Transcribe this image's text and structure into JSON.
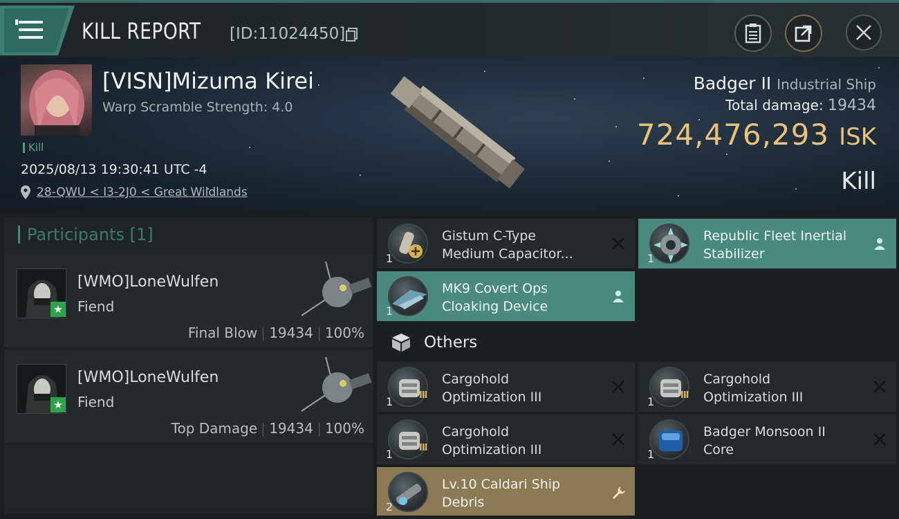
{
  "header": {
    "title": "KILL REPORT",
    "report_id": "[ID:11024450]",
    "icons": [
      "menu-icon",
      "copy-icon",
      "clipboard-icon",
      "share-icon",
      "close-icon"
    ]
  },
  "victim": {
    "name": "[VISN]Mizuma Kirei",
    "warp_scramble": "Warp Scramble Strength: 4.0",
    "result_tag": "Kill",
    "timestamp": "2025/08/13 19:30:41 UTC -4",
    "location": "28-QWU < I3-2J0 < Great Wildlands",
    "ship_name": "Badger II",
    "ship_class": "Industrial Ship",
    "total_damage_label": "Total damage:",
    "total_damage": "19434",
    "isk_value": "724,476,293",
    "isk_unit": "ISK",
    "outcome": "Kill"
  },
  "participants": {
    "header": "Participants",
    "count": "[1]",
    "rows": [
      {
        "name": "[WMO]LoneWulfen",
        "ship": "Fiend",
        "role": "Final Blow",
        "damage": "19434",
        "percent": "100%"
      },
      {
        "name": "[WMO]LoneWulfen",
        "ship": "Fiend",
        "role": "Top Damage",
        "damage": "19434",
        "percent": "100%"
      }
    ]
  },
  "items": [
    {
      "qty": "1",
      "name_l1": "Gistum C-Type",
      "name_l2": "Medium Capacitor...",
      "state": "destroyed",
      "icon": "capacitor-icon"
    },
    {
      "qty": "1",
      "name_l1": "Republic Fleet Inertial",
      "name_l2": "Stabilizer",
      "state": "dropped",
      "icon": "stabilizer-icon"
    },
    {
      "qty": "1",
      "name_l1": "MK9 Covert Ops",
      "name_l2": "Cloaking Device",
      "state": "dropped",
      "icon": "cloak-icon"
    }
  ],
  "others": {
    "label": "Others",
    "items": [
      {
        "qty": "1",
        "name_l1": "Cargohold",
        "name_l2": "Optimization III",
        "state": "destroyed",
        "tier": "III"
      },
      {
        "qty": "1",
        "name_l1": "Cargohold",
        "name_l2": "Optimization III",
        "state": "destroyed",
        "tier": "III"
      },
      {
        "qty": "1",
        "name_l1": "Cargohold",
        "name_l2": "Optimization III",
        "state": "destroyed",
        "tier": "III"
      },
      {
        "qty": "1",
        "name_l1": "Badger Monsoon II",
        "name_l2": "Core",
        "state": "destroyed",
        "tier": ""
      },
      {
        "qty": "2",
        "name_l1": "Lv.10 Caldari Ship",
        "name_l2": "Debris",
        "state": "salvage",
        "tier": ""
      }
    ]
  },
  "colors": {
    "accent_teal": "#4a8a7e",
    "isk_gold": "#e9c37a",
    "salvage_gold": "#8c7a54",
    "badge_green": "#2fa24a"
  }
}
